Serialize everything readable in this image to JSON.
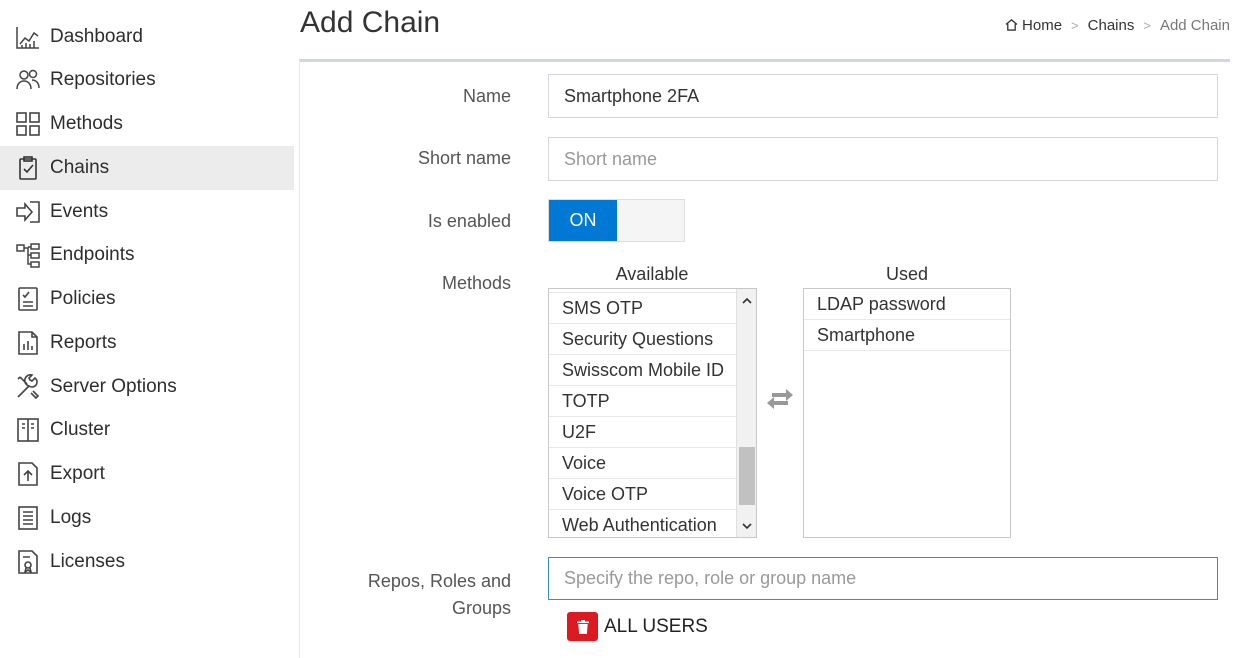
{
  "sidebar": {
    "items": [
      {
        "label": "Dashboard",
        "icon": "dashboard-icon",
        "active": false
      },
      {
        "label": "Repositories",
        "icon": "users-icon",
        "active": false
      },
      {
        "label": "Methods",
        "icon": "grid-icon",
        "active": false
      },
      {
        "label": "Chains",
        "icon": "clipboard-check-icon",
        "active": true
      },
      {
        "label": "Events",
        "icon": "sign-in-icon",
        "active": false
      },
      {
        "label": "Endpoints",
        "icon": "sitemap-icon",
        "active": false
      },
      {
        "label": "Policies",
        "icon": "checklist-icon",
        "active": false
      },
      {
        "label": "Reports",
        "icon": "report-icon",
        "active": false
      },
      {
        "label": "Server Options",
        "icon": "tools-icon",
        "active": false
      },
      {
        "label": "Cluster",
        "icon": "cluster-icon",
        "active": false
      },
      {
        "label": "Export",
        "icon": "export-icon",
        "active": false
      },
      {
        "label": "Logs",
        "icon": "log-icon",
        "active": false
      },
      {
        "label": "Licenses",
        "icon": "license-icon",
        "active": false
      }
    ]
  },
  "header": {
    "title": "Add Chain",
    "breadcrumb": {
      "home": "Home",
      "section": "Chains",
      "current": "Add Chain",
      "separator": ">"
    }
  },
  "form": {
    "name": {
      "label": "Name",
      "value": "Smartphone 2FA"
    },
    "short_name": {
      "label": "Short name",
      "value": "",
      "placeholder": "Short name"
    },
    "enabled": {
      "label": "Is enabled",
      "state": "ON"
    },
    "methods": {
      "label": "Methods",
      "available_title": "Available",
      "used_title": "Used",
      "available": [
        "SMS OTP",
        "Security Questions",
        "Swisscom Mobile ID",
        "TOTP",
        "U2F",
        "Voice",
        "Voice OTP",
        "Web Authentication"
      ],
      "used": [
        "LDAP password",
        "Smartphone"
      ]
    },
    "repos": {
      "label_line1": "Repos, Roles and",
      "label_line2": "Groups",
      "placeholder": "Specify the repo, role or group name",
      "tags": [
        "ALL USERS"
      ]
    }
  },
  "colors": {
    "accent": "#0078d4",
    "delete": "#dd1a22",
    "active_nav": "#ececec",
    "focus_border": "#3c8dbc"
  }
}
